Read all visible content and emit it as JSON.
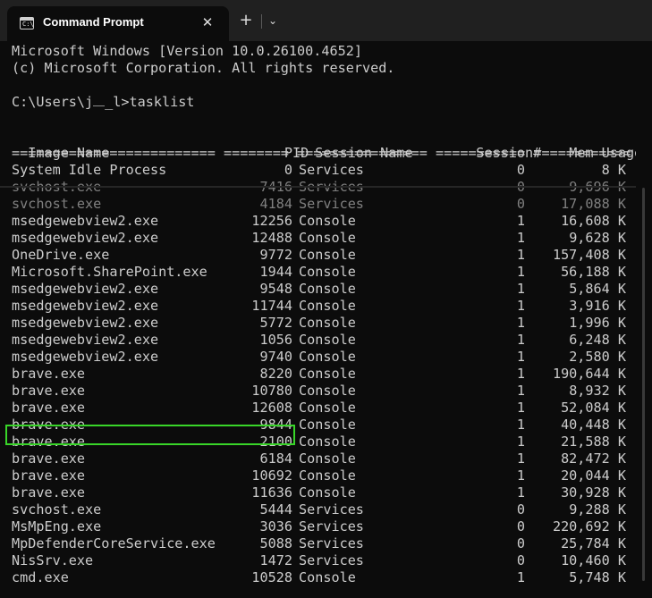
{
  "window": {
    "tab_title": "Command Prompt",
    "tab_icon": "cmd-icon",
    "close_icon": "✕",
    "new_tab_icon": "+",
    "dropdown_icon": "⌄"
  },
  "terminal": {
    "banner_line1": "Microsoft Windows [Version 10.0.26100.4652]",
    "banner_line2": "(c) Microsoft Corporation. All rights reserved.",
    "prompt_prefix": "C:\\Users\\j",
    "prompt_suffix": "_l>tasklist",
    "header": {
      "name": "Image Name",
      "pid": "PID",
      "session_name": "Session Name",
      "session_num": "Session#",
      "mem": "Mem Usage"
    },
    "separator": "========================= ======== ================ =========== ============",
    "rows": [
      {
        "name": "System Idle Process",
        "pid": "0",
        "session": "Services",
        "num": "0",
        "mem": "8 K"
      },
      {
        "name": "svchost.exe",
        "pid": "7416",
        "session": "Services",
        "num": "0",
        "mem": "9,696 K"
      },
      {
        "name": "svchost.exe",
        "pid": "4184",
        "session": "Services",
        "num": "0",
        "mem": "17,088 K"
      },
      {
        "name": "msedgewebview2.exe",
        "pid": "12256",
        "session": "Console",
        "num": "1",
        "mem": "16,608 K"
      },
      {
        "name": "msedgewebview2.exe",
        "pid": "12488",
        "session": "Console",
        "num": "1",
        "mem": "9,628 K"
      },
      {
        "name": "OneDrive.exe",
        "pid": "9772",
        "session": "Console",
        "num": "1",
        "mem": "157,408 K"
      },
      {
        "name": "Microsoft.SharePoint.exe",
        "pid": "1944",
        "session": "Console",
        "num": "1",
        "mem": "56,188 K"
      },
      {
        "name": "msedgewebview2.exe",
        "pid": "9548",
        "session": "Console",
        "num": "1",
        "mem": "5,864 K"
      },
      {
        "name": "msedgewebview2.exe",
        "pid": "11744",
        "session": "Console",
        "num": "1",
        "mem": "3,916 K"
      },
      {
        "name": "msedgewebview2.exe",
        "pid": "5772",
        "session": "Console",
        "num": "1",
        "mem": "1,996 K"
      },
      {
        "name": "msedgewebview2.exe",
        "pid": "1056",
        "session": "Console",
        "num": "1",
        "mem": "6,248 K"
      },
      {
        "name": "msedgewebview2.exe",
        "pid": "9740",
        "session": "Console",
        "num": "1",
        "mem": "2,580 K"
      },
      {
        "name": "brave.exe",
        "pid": "8220",
        "session": "Console",
        "num": "1",
        "mem": "190,644 K"
      },
      {
        "name": "brave.exe",
        "pid": "10780",
        "session": "Console",
        "num": "1",
        "mem": "8,932 K"
      },
      {
        "name": "brave.exe",
        "pid": "12608",
        "session": "Console",
        "num": "1",
        "mem": "52,084 K"
      },
      {
        "name": "brave.exe",
        "pid": "9844",
        "session": "Console",
        "num": "1",
        "mem": "40,448 K"
      },
      {
        "name": "brave.exe",
        "pid": "2100",
        "session": "Console",
        "num": "1",
        "mem": "21,588 K"
      },
      {
        "name": "brave.exe",
        "pid": "6184",
        "session": "Console",
        "num": "1",
        "mem": "82,472 K"
      },
      {
        "name": "brave.exe",
        "pid": "10692",
        "session": "Console",
        "num": "1",
        "mem": "20,044 K"
      },
      {
        "name": "brave.exe",
        "pid": "11636",
        "session": "Console",
        "num": "1",
        "mem": "30,928 K"
      },
      {
        "name": "svchost.exe",
        "pid": "5444",
        "session": "Services",
        "num": "0",
        "mem": "9,288 K"
      },
      {
        "name": "MsMpEng.exe",
        "pid": "3036",
        "session": "Services",
        "num": "0",
        "mem": "220,692 K"
      },
      {
        "name": "MpDefenderCoreService.exe",
        "pid": "5088",
        "session": "Services",
        "num": "0",
        "mem": "25,784 K"
      },
      {
        "name": "NisSrv.exe",
        "pid": "1472",
        "session": "Services",
        "num": "0",
        "mem": "10,460 K"
      },
      {
        "name": "cmd.exe",
        "pid": "10528",
        "session": "Console",
        "num": "1",
        "mem": "5,748 K"
      }
    ]
  },
  "highlighted_row": "brave.exe 9844",
  "colors": {
    "background": "#0c0c0c",
    "text": "#cccccc",
    "titlebar": "#202020",
    "highlight": "#39d629"
  }
}
